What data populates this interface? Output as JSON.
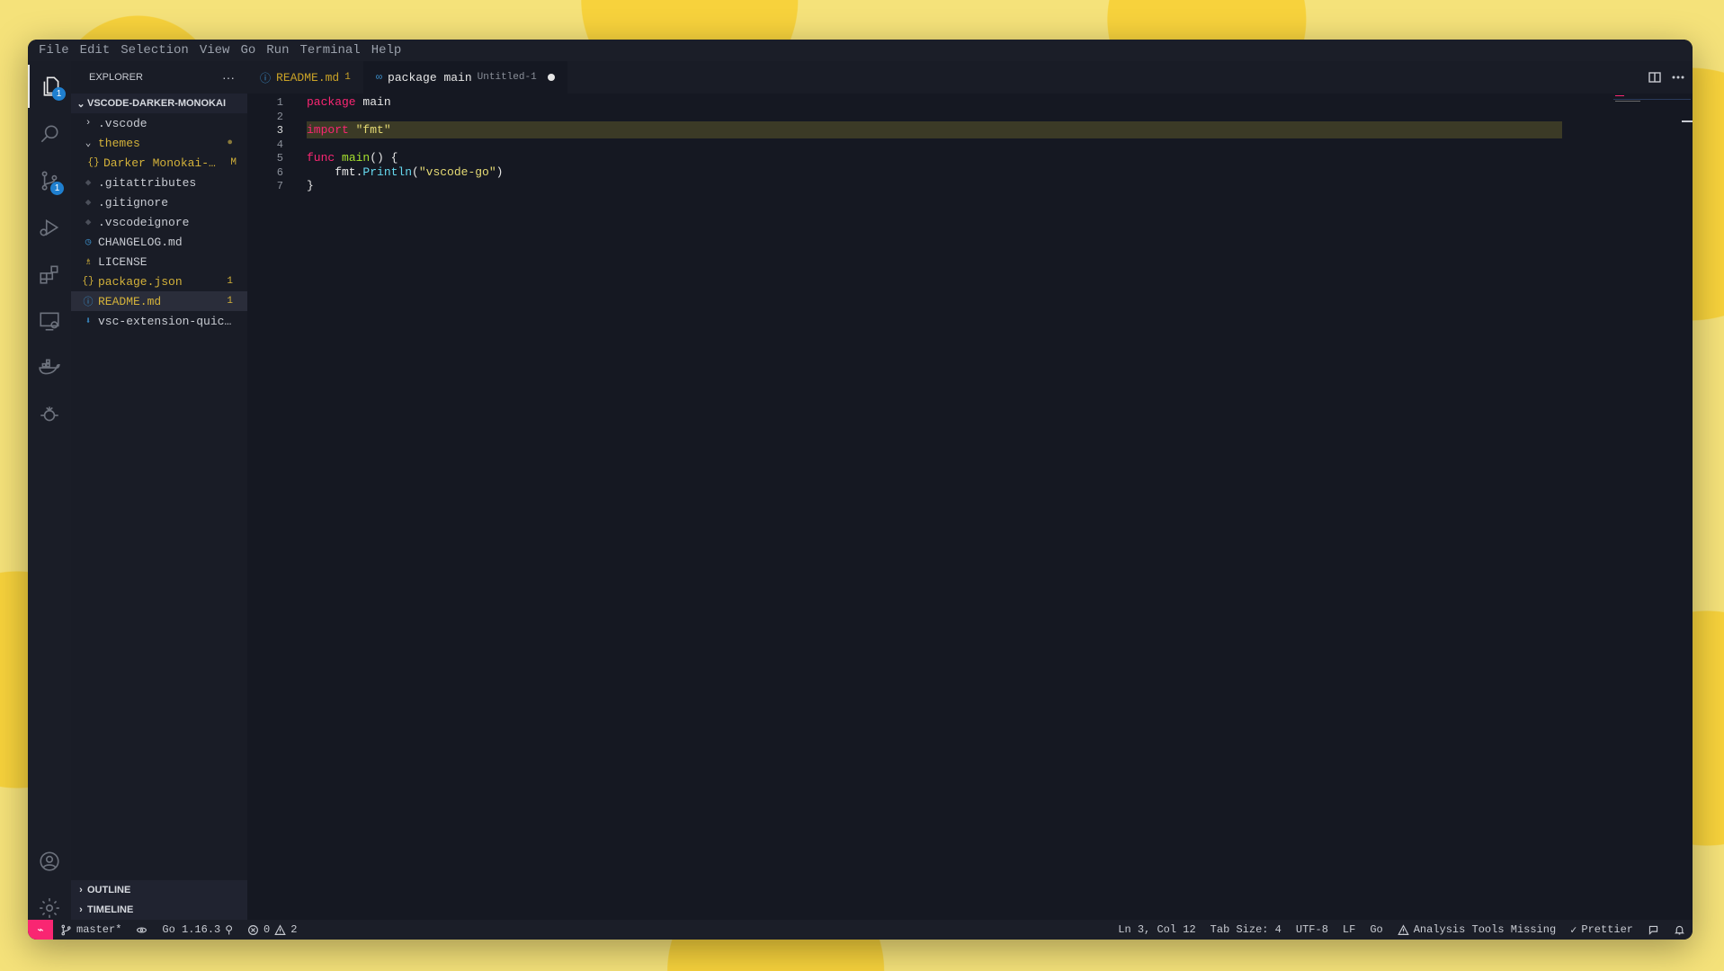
{
  "menu": [
    "File",
    "Edit",
    "Selection",
    "View",
    "Go",
    "Run",
    "Terminal",
    "Help"
  ],
  "activity": {
    "explorer_badge": "1",
    "scm_badge": "1"
  },
  "sidebar": {
    "title": "EXPLORER",
    "more": "···",
    "root": "VSCODE-DARKER-MONOKAI",
    "items": [
      {
        "label": ".vscode",
        "icon": "chevron-right",
        "color": "#c8cbd2",
        "deco": ""
      },
      {
        "label": "themes",
        "icon": "chevron-down",
        "color": "#d4b23a",
        "deco": "●"
      },
      {
        "label": "Darker Monokai-…",
        "icon": "json-icon",
        "color": "#d4b23a",
        "deco": "M"
      },
      {
        "label": ".gitattributes",
        "icon": "git-icon",
        "color": "#c8cbd2",
        "deco": ""
      },
      {
        "label": ".gitignore",
        "icon": "git-icon",
        "color": "#c8cbd2",
        "deco": ""
      },
      {
        "label": ".vscodeignore",
        "icon": "git-icon",
        "color": "#c8cbd2",
        "deco": ""
      },
      {
        "label": "CHANGELOG.md",
        "icon": "clock-icon",
        "color": "#c8cbd2",
        "deco": ""
      },
      {
        "label": "LICENSE",
        "icon": "license-icon",
        "color": "#c8cbd2",
        "deco": ""
      },
      {
        "label": "package.json",
        "icon": "json-icon",
        "color": "#d4b23a",
        "deco": "1"
      },
      {
        "label": "README.md",
        "icon": "info-icon",
        "color": "#d4b23a",
        "deco": "1"
      },
      {
        "label": "vsc-extension-quick…",
        "icon": "download-icon",
        "color": "#c8cbd2",
        "deco": ""
      }
    ],
    "outline": "OUTLINE",
    "timeline": "TIMELINE"
  },
  "tabs": [
    {
      "label": "README.md",
      "badge": "1"
    },
    {
      "label": "package main",
      "sub": "Untitled-1"
    }
  ],
  "code": {
    "line_numbers": [
      "1",
      "2",
      "3",
      "4",
      "5",
      "6",
      "7"
    ],
    "l1_kw": "package",
    "l1_rest": " main",
    "l3_kw": "import",
    "l3_str": " \"fmt\"",
    "l5_kw": "func",
    "l5_fn": " main",
    "l5_rest": "() {",
    "l6_a": "    fmt.",
    "l6_fn": "Println",
    "l6_b": "(",
    "l6_str": "\"vscode-go\"",
    "l6_c": ")",
    "l7": "}"
  },
  "status": {
    "branch": "master*",
    "go_version": "Go 1.16.3",
    "errors": "0",
    "warnings": "2",
    "position": "Ln 3, Col 12",
    "tab_size": "Tab Size: 4",
    "encoding": "UTF-8",
    "eol": "LF",
    "language": "Go",
    "analysis": "Analysis Tools Missing",
    "prettier": "Prettier"
  }
}
